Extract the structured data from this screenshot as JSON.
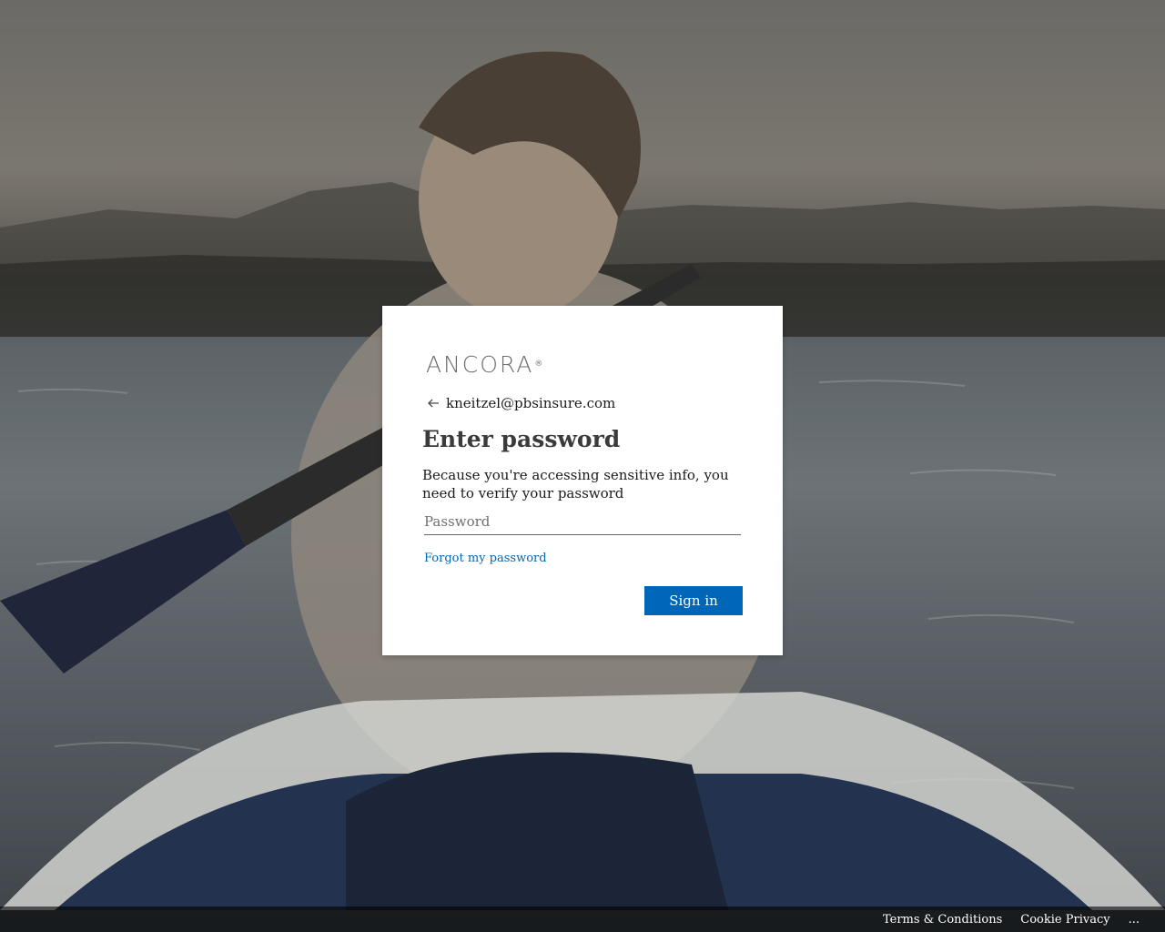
{
  "brand": {
    "logo_text": "ANCORA",
    "logo_mark": "®"
  },
  "identity": {
    "icon": "back-arrow-icon",
    "email": "kneitzel@pbsinsure.com"
  },
  "form": {
    "title": "Enter password",
    "description": "Because you're accessing sensitive info, you need to verify your password",
    "password_placeholder": "Password",
    "password_value": "",
    "forgot_link": "Forgot my password",
    "submit_label": "Sign in"
  },
  "footer": {
    "links": [
      "Terms & Conditions",
      "Cookie Privacy",
      "..."
    ]
  },
  "colors": {
    "accent": "#0067b8",
    "card_background": "#ffffff",
    "footer_background": "rgba(0,0,0,0.6)"
  }
}
